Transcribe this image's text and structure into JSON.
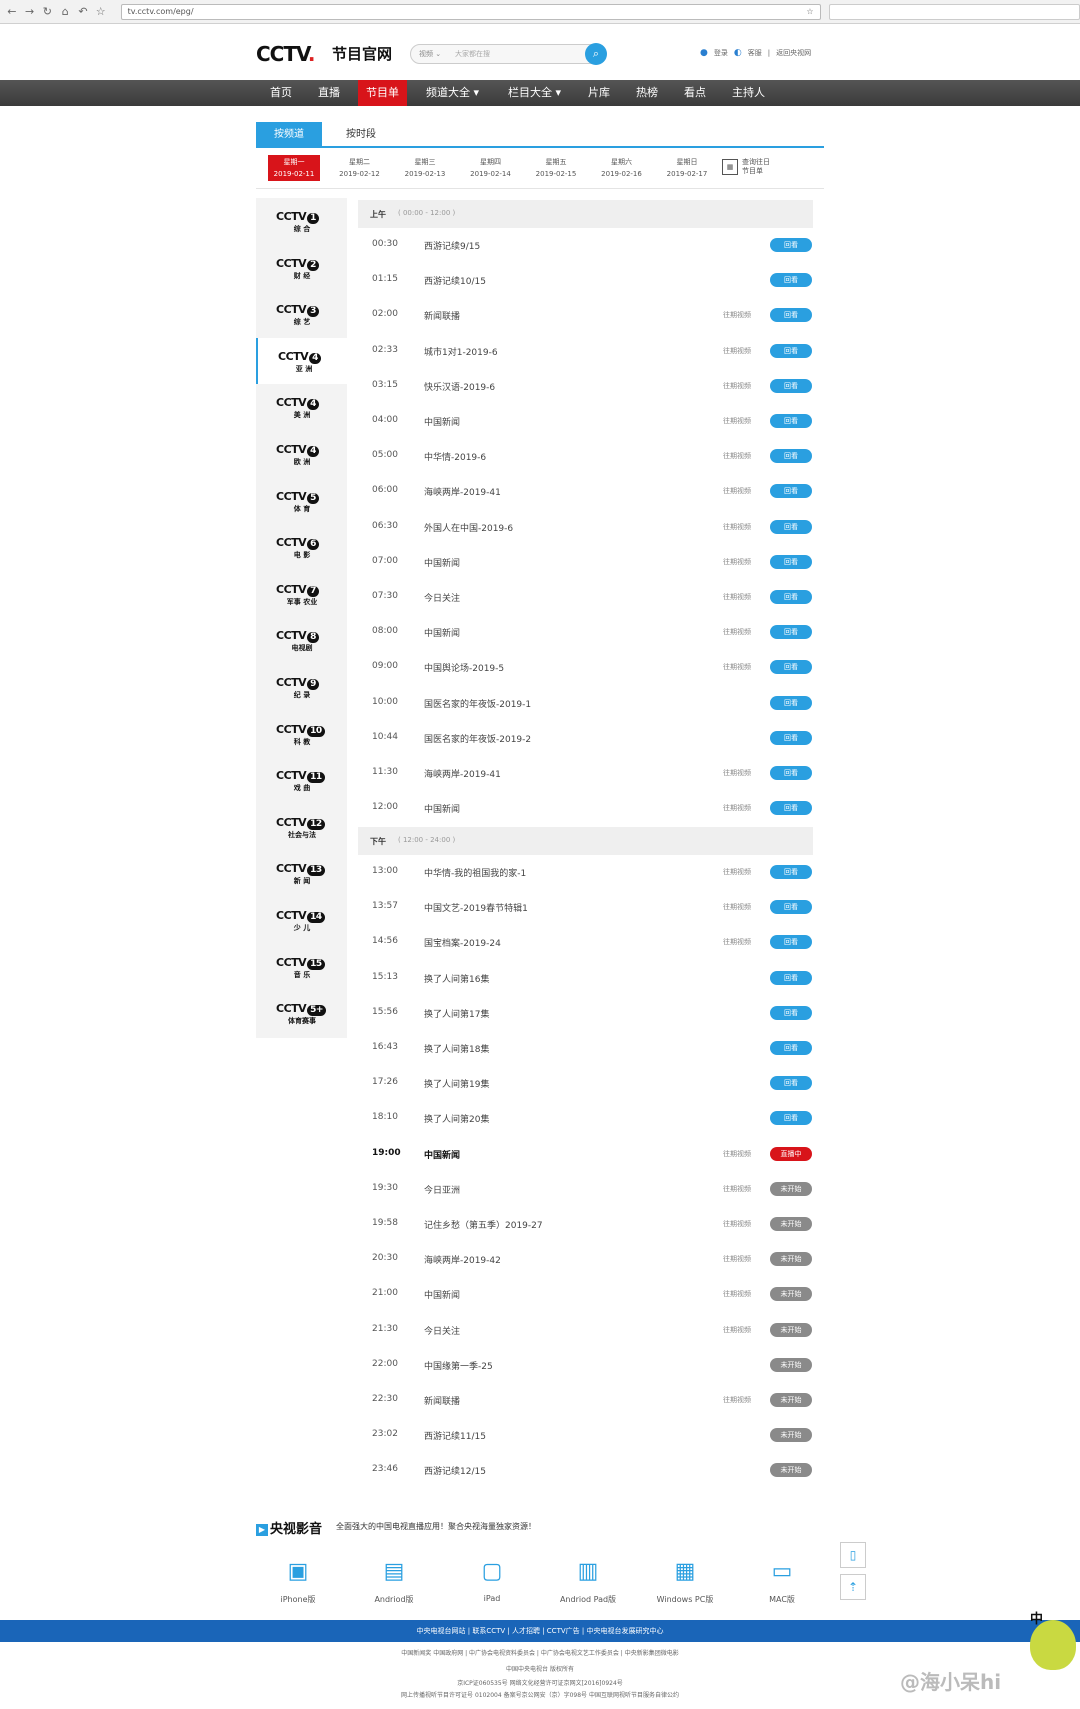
{
  "browser": {
    "url": "tv.cctv.com/epg/"
  },
  "header": {
    "logo": "CCTV",
    "logo_sub": "节目官网",
    "search_category": "视频 ⌄",
    "search_placeholder": "大家都在搜",
    "login": "登录",
    "feedback": "客服",
    "back_link": "返回央视网"
  },
  "nav": [
    "首页",
    "直播",
    "节目单",
    "频道大全 ▾",
    "栏目大全 ▾",
    "片库",
    "热榜",
    "看点",
    "主持人"
  ],
  "tabs": [
    "按频道",
    "按时段"
  ],
  "days": [
    {
      "w": "星期一",
      "d": "2019-02-11"
    },
    {
      "w": "星期二",
      "d": "2019-02-12"
    },
    {
      "w": "星期三",
      "d": "2019-02-13"
    },
    {
      "w": "星期四",
      "d": "2019-02-14"
    },
    {
      "w": "星期五",
      "d": "2019-02-15"
    },
    {
      "w": "星期六",
      "d": "2019-02-16"
    },
    {
      "w": "星期日",
      "d": "2019-02-17"
    }
  ],
  "calendar": {
    "l1": "查询往日",
    "l2": "节目单"
  },
  "channels": [
    {
      "n": "1",
      "name": "综 合"
    },
    {
      "n": "2",
      "name": "财 经"
    },
    {
      "n": "3",
      "name": "综 艺"
    },
    {
      "n": "4",
      "name": "亚 洲"
    },
    {
      "n": "4",
      "name": "美 洲"
    },
    {
      "n": "4",
      "name": "欧 洲"
    },
    {
      "n": "5",
      "name": "体 育"
    },
    {
      "n": "6",
      "name": "电 影"
    },
    {
      "n": "7",
      "name": "军事 农业"
    },
    {
      "n": "8",
      "name": "电视剧"
    },
    {
      "n": "9",
      "name": "纪 录"
    },
    {
      "n": "10",
      "name": "科 教"
    },
    {
      "n": "11",
      "name": "戏 曲"
    },
    {
      "n": "12",
      "name": "社会与法"
    },
    {
      "n": "13",
      "name": "新 闻"
    },
    {
      "n": "14",
      "name": "少 儿"
    },
    {
      "n": "15",
      "name": "音 乐"
    },
    {
      "n": "5+",
      "name": "体育赛事"
    }
  ],
  "am": {
    "label": "上午",
    "range": "( 00:00 - 12:00 )"
  },
  "pm": {
    "label": "下午",
    "range": "( 12:00 - 24:00 )"
  },
  "video_label": "往期视频",
  "status": {
    "replay": "回看",
    "live": "直播中",
    "soon": "未开始"
  },
  "am_rows": [
    {
      "t": "00:30",
      "n": "西游记续9/15",
      "v": false,
      "s": "replay"
    },
    {
      "t": "01:15",
      "n": "西游记续10/15",
      "v": false,
      "s": "replay"
    },
    {
      "t": "02:00",
      "n": "新闻联播",
      "v": true,
      "s": "replay"
    },
    {
      "t": "02:33",
      "n": "城市1对1-2019-6",
      "v": true,
      "s": "replay"
    },
    {
      "t": "03:15",
      "n": "快乐汉语-2019-6",
      "v": true,
      "s": "replay"
    },
    {
      "t": "04:00",
      "n": "中国新闻",
      "v": true,
      "s": "replay"
    },
    {
      "t": "05:00",
      "n": "中华情-2019-6",
      "v": true,
      "s": "replay"
    },
    {
      "t": "06:00",
      "n": "海峡两岸-2019-41",
      "v": true,
      "s": "replay"
    },
    {
      "t": "06:30",
      "n": "外国人在中国-2019-6",
      "v": true,
      "s": "replay"
    },
    {
      "t": "07:00",
      "n": "中国新闻",
      "v": true,
      "s": "replay"
    },
    {
      "t": "07:30",
      "n": "今日关注",
      "v": true,
      "s": "replay"
    },
    {
      "t": "08:00",
      "n": "中国新闻",
      "v": true,
      "s": "replay"
    },
    {
      "t": "09:00",
      "n": "中国舆论场-2019-5",
      "v": true,
      "s": "replay"
    },
    {
      "t": "10:00",
      "n": "国医名家的年夜饭-2019-1",
      "v": false,
      "s": "replay"
    },
    {
      "t": "10:44",
      "n": "国医名家的年夜饭-2019-2",
      "v": false,
      "s": "replay"
    },
    {
      "t": "11:30",
      "n": "海峡两岸-2019-41",
      "v": true,
      "s": "replay"
    },
    {
      "t": "12:00",
      "n": "中国新闻",
      "v": true,
      "s": "replay"
    }
  ],
  "pm_rows": [
    {
      "t": "13:00",
      "n": "中华情-我的祖国我的家-1",
      "v": true,
      "s": "replay"
    },
    {
      "t": "13:57",
      "n": "中国文艺-2019春节特辑1",
      "v": true,
      "s": "replay"
    },
    {
      "t": "14:56",
      "n": "国宝档案-2019-24",
      "v": true,
      "s": "replay"
    },
    {
      "t": "15:13",
      "n": "换了人间第16集",
      "v": false,
      "s": "replay"
    },
    {
      "t": "15:56",
      "n": "换了人间第17集",
      "v": false,
      "s": "replay"
    },
    {
      "t": "16:43",
      "n": "换了人间第18集",
      "v": false,
      "s": "replay"
    },
    {
      "t": "17:26",
      "n": "换了人间第19集",
      "v": false,
      "s": "replay"
    },
    {
      "t": "18:10",
      "n": "换了人间第20集",
      "v": false,
      "s": "replay"
    },
    {
      "t": "19:00",
      "n": "中国新闻",
      "v": true,
      "s": "live"
    },
    {
      "t": "19:30",
      "n": "今日亚洲",
      "v": true,
      "s": "soon"
    },
    {
      "t": "19:58",
      "n": "记住乡愁（第五季）2019-27",
      "v": true,
      "s": "soon"
    },
    {
      "t": "20:30",
      "n": "海峡两岸-2019-42",
      "v": true,
      "s": "soon"
    },
    {
      "t": "21:00",
      "n": "中国新闻",
      "v": true,
      "s": "soon"
    },
    {
      "t": "21:30",
      "n": "今日关注",
      "v": true,
      "s": "soon"
    },
    {
      "t": "22:00",
      "n": "中国缘第一季-25",
      "v": false,
      "s": "soon"
    },
    {
      "t": "22:30",
      "n": "新闻联播",
      "v": true,
      "s": "soon"
    },
    {
      "t": "23:02",
      "n": "西游记续11/15",
      "v": false,
      "s": "soon"
    },
    {
      "t": "23:46",
      "n": "西游记续12/15",
      "v": false,
      "s": "soon"
    }
  ],
  "promo": {
    "logo": "央视影音",
    "text": "全面强大的中国电视直播应用！聚合央视海量独家资源！",
    "apps": [
      "iPhone版",
      "Andriod版",
      "iPad",
      "Andriod Pad版",
      "Windows PC版",
      "MAC版"
    ]
  },
  "footer": {
    "bar": "中央电视台网站  |  联系CCTV  |  人才招聘  |  CCTV广告  |  中央电视台发展研究中心",
    "line1": "中国新闻奖  中国政府网  |  中广协会电视资料委员会  |  中广协会电视文艺工作委员会  |  中央新影集团微电影",
    "line2": "中国中央电视台 版权所有",
    "line3": "京ICP证060535号    网络文化经营许可证京网文[2016]0924号",
    "line4": "网上传播视听节目许可证号 0102004    备案号京公网安（京）字098号    中国互联网视听节目服务自律公约"
  },
  "watermark": "@海小呆hi"
}
